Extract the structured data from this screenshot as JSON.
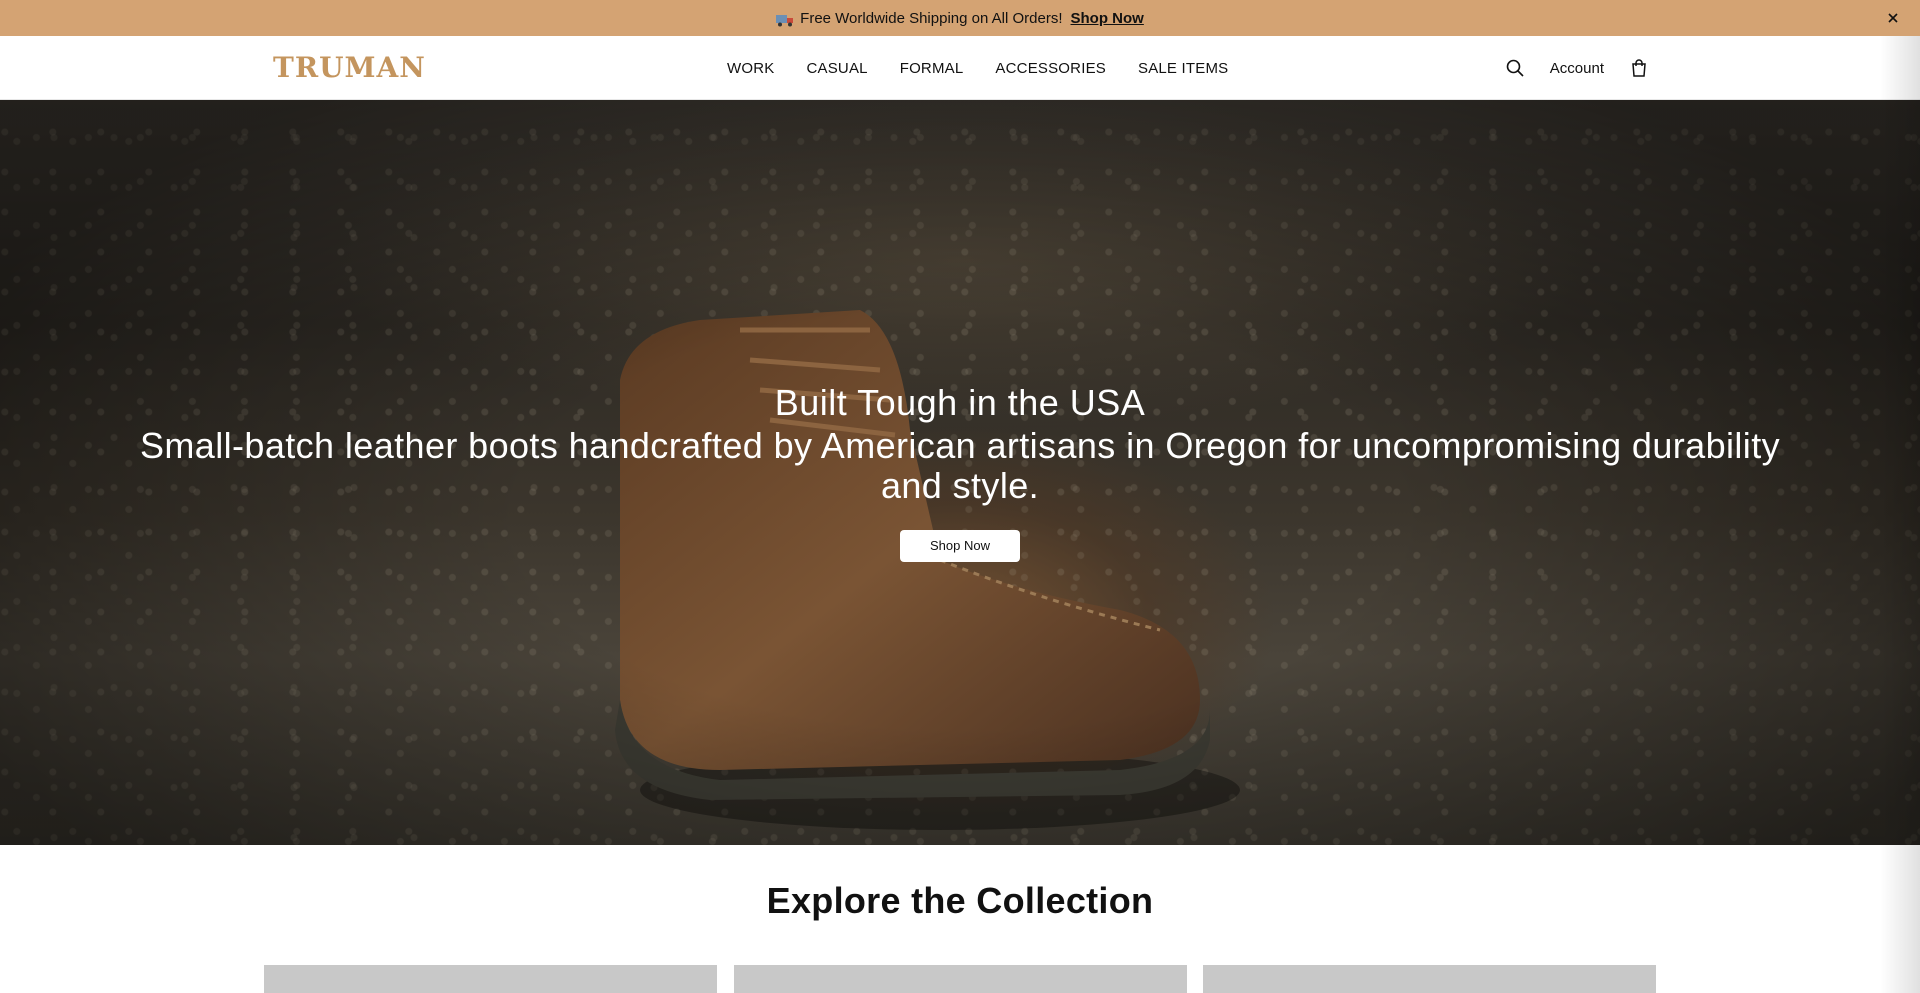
{
  "announcement": {
    "message": "Free Worldwide Shipping on All Orders!",
    "link_label": "Shop Now",
    "icon": "truck-icon",
    "close_icon": "close-icon",
    "background": "#d4a373"
  },
  "header": {
    "logo": "TRUMAN",
    "logo_color": "#c4955e",
    "nav": [
      {
        "label": "WORK"
      },
      {
        "label": "CASUAL"
      },
      {
        "label": "FORMAL"
      },
      {
        "label": "ACCESSORIES"
      },
      {
        "label": "SALE ITEMS"
      }
    ],
    "search_icon": "search-icon",
    "account_label": "Account",
    "cart_icon": "shopping-bag-icon"
  },
  "hero": {
    "title": "Built Tough in the USA",
    "subtitle": "Small-batch leather boots handcrafted by American artisans in Oregon for uncompromising durability and style.",
    "button_label": "Shop Now"
  },
  "collection": {
    "title": "Explore the Collection",
    "cards_count": 3
  }
}
